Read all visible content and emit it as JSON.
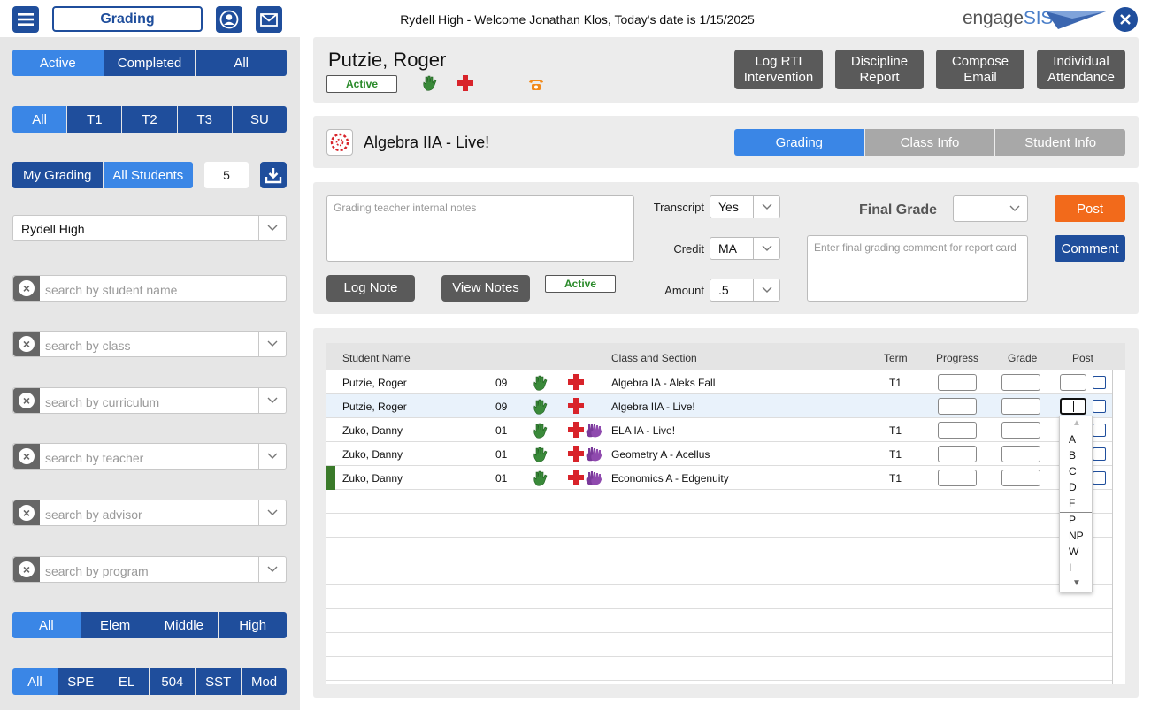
{
  "header": {
    "mode_label": "Grading",
    "welcome": "Rydell High - Welcome Jonathan Klos, Today's date is 1/15/2025",
    "logo_main": "engage",
    "logo_accent": "SIS",
    "icons": [
      "menu-icon",
      "user-icon",
      "mail-icon",
      "close-icon"
    ]
  },
  "sidebar": {
    "status_tabs": [
      "Active",
      "Completed",
      "All"
    ],
    "term_tabs": [
      "All",
      "T1",
      "T2",
      "T3",
      "SU"
    ],
    "grading_tabs": [
      "My Grading",
      "All Students"
    ],
    "count": "5",
    "school": "Rydell High",
    "searches": [
      {
        "placeholder": "search by student name"
      },
      {
        "placeholder": "search by class"
      },
      {
        "placeholder": "search by curriculum"
      },
      {
        "placeholder": "search by teacher"
      },
      {
        "placeholder": "search by advisor"
      },
      {
        "placeholder": "search by program"
      }
    ],
    "level_tabs": [
      "All",
      "Elem",
      "Middle",
      "High"
    ],
    "program_tabs": [
      "All",
      "SPE",
      "EL",
      "504",
      "SST",
      "Mod"
    ]
  },
  "student": {
    "name": "Putzie, Roger",
    "status": "Active",
    "actions": [
      "Log RTI\nIntervention",
      "Discipline\nReport",
      "Compose\nEmail",
      "Individual\nAttendance"
    ]
  },
  "class_panel": {
    "title": "Algebra IIA - Live!",
    "tabs": [
      "Grading",
      "Class Info",
      "Student Info"
    ]
  },
  "grading_form": {
    "notes_placeholder": "Grading teacher internal notes",
    "log_note": "Log Note",
    "view_notes": "View Notes",
    "status": "Active",
    "transcript_label": "Transcript",
    "transcript_value": "Yes",
    "credit_label": "Credit",
    "credit_value": "MA",
    "amount_label": "Amount",
    "amount_value": ".5",
    "final_grade_label": "Final Grade",
    "final_grade_value": "",
    "comment_placeholder": "Enter final grading comment for report card",
    "post": "Post",
    "comment": "Comment",
    "colors": {
      "post": "#f26a1b",
      "primary": "#1f4e9c",
      "active_tab": "#3a86e6"
    }
  },
  "table": {
    "columns": [
      "Student Name",
      "Class and Section",
      "Term",
      "Progress",
      "Grade",
      "Post"
    ],
    "rows": [
      {
        "name": "Putzie, Roger",
        "grade": "09",
        "class": "Algebra IA - Aleks Fall",
        "term": "T1",
        "extra": false,
        "flag": false,
        "selected": false
      },
      {
        "name": "Putzie, Roger",
        "grade": "09",
        "class": "Algebra IIA - Live!",
        "term": "",
        "extra": false,
        "flag": false,
        "selected": true
      },
      {
        "name": "Zuko, Danny",
        "grade": "01",
        "class": "ELA IA - Live!",
        "term": "T1",
        "extra": true,
        "flag": false,
        "selected": false
      },
      {
        "name": "Zuko, Danny",
        "grade": "01",
        "class": "Geometry A - Acellus",
        "term": "T1",
        "extra": true,
        "flag": false,
        "selected": false
      },
      {
        "name": "Zuko, Danny",
        "grade": "01",
        "class": "Economics A - Edgenuity",
        "term": "T1",
        "extra": true,
        "flag": true,
        "selected": false
      }
    ],
    "dropdown_options": [
      "A",
      "B",
      "C",
      "D",
      "F",
      "P",
      "NP",
      "W",
      "I"
    ]
  }
}
